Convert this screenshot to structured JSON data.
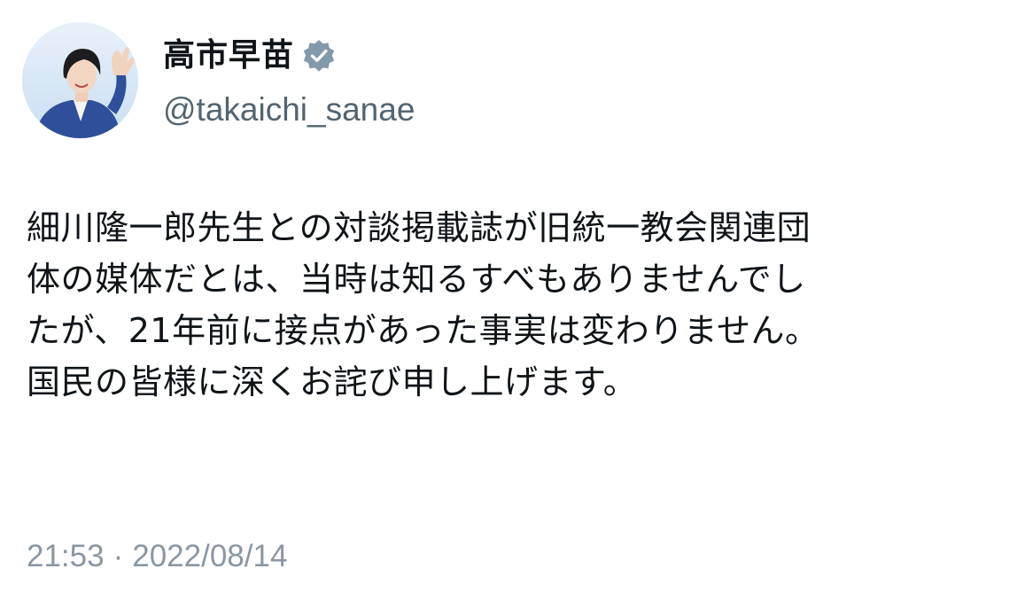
{
  "author": {
    "display_name": "高市早苗",
    "handle": "@takaichi_sanae",
    "verified": true,
    "verified_color": "#829aab"
  },
  "tweet": {
    "lines": [
      "細川隆一郎先生との対談掲載誌が旧統一教会関連団",
      "体の媒体だとは、当時は知るすべもありませんでし",
      "たが、21年前に接点があった事実は変わりません。",
      "国民の皆様に深くお詫び申し上げます。"
    ]
  },
  "meta": {
    "time": "21:53",
    "separator": "·",
    "date": "2022/08/14"
  },
  "colors": {
    "text": "#0f1419",
    "secondary": "#536471",
    "timestamp": "#8a96a3",
    "background": "#ffffff"
  }
}
